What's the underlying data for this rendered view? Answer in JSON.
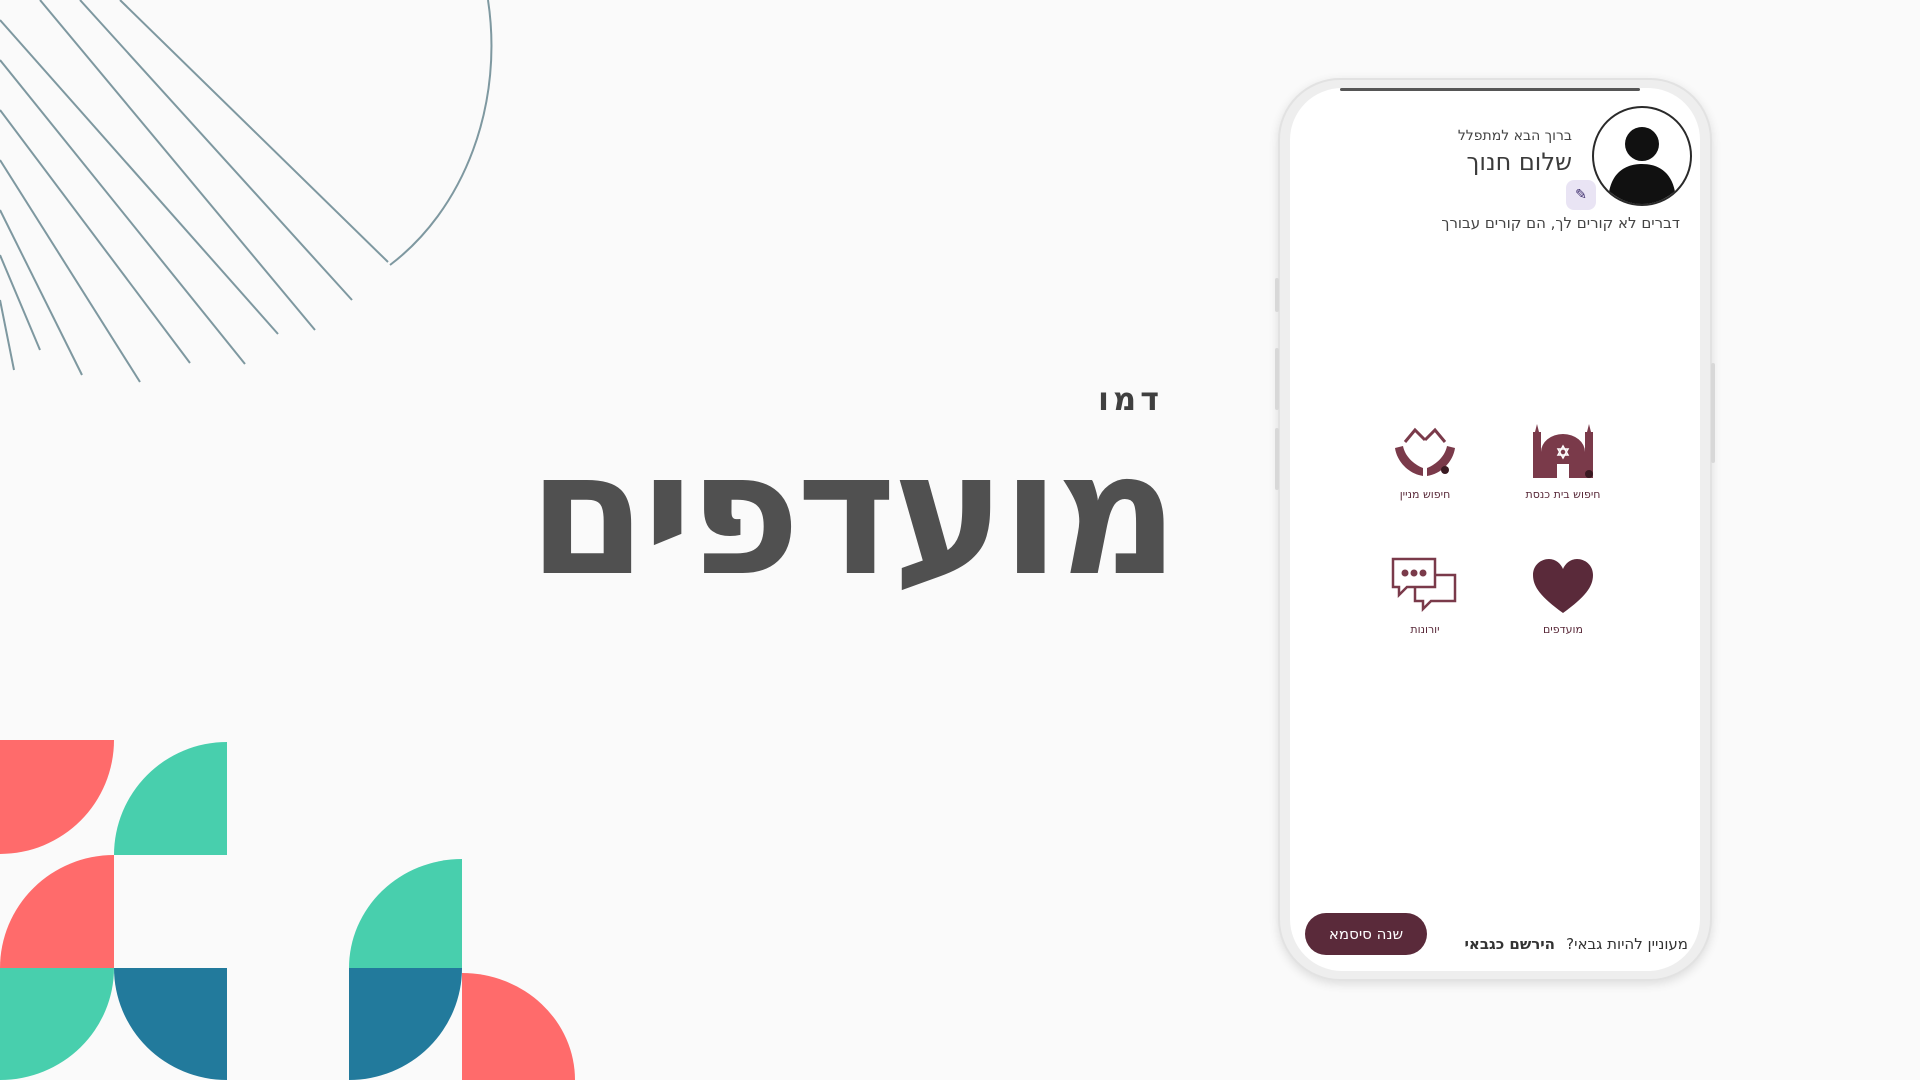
{
  "slide": {
    "subtitle": "דמו",
    "title": "מועדפים"
  },
  "colors": {
    "coral": "#ff6b6b",
    "teal": "#48cfad",
    "blue": "#227a9c",
    "line": "#7e98a0",
    "heading": "#505050",
    "brand": "#5a2a3a"
  },
  "app": {
    "welcome": "ברוך הבא למתפלל",
    "user_name": "שלום חנוך",
    "tagline": "דברים לא קורים לך, הם קורים עבורך",
    "avatar_icon": "user-silhouette-icon",
    "edit_icon": "pencil-icon",
    "tiles": [
      {
        "label": "חיפוש בית כנסת",
        "icon": "synagogue-icon"
      },
      {
        "label": "חיפוש מניין",
        "icon": "praying-hands-icon"
      },
      {
        "label": "מועדפים",
        "icon": "heart-icon"
      },
      {
        "label": "יורונות",
        "icon": "chat-bubbles-icon"
      }
    ],
    "cta_question": "מעוניין להיות גבאי?",
    "cta_register": "הירשם כגבאי",
    "change_password": "שנה סיסמא"
  }
}
